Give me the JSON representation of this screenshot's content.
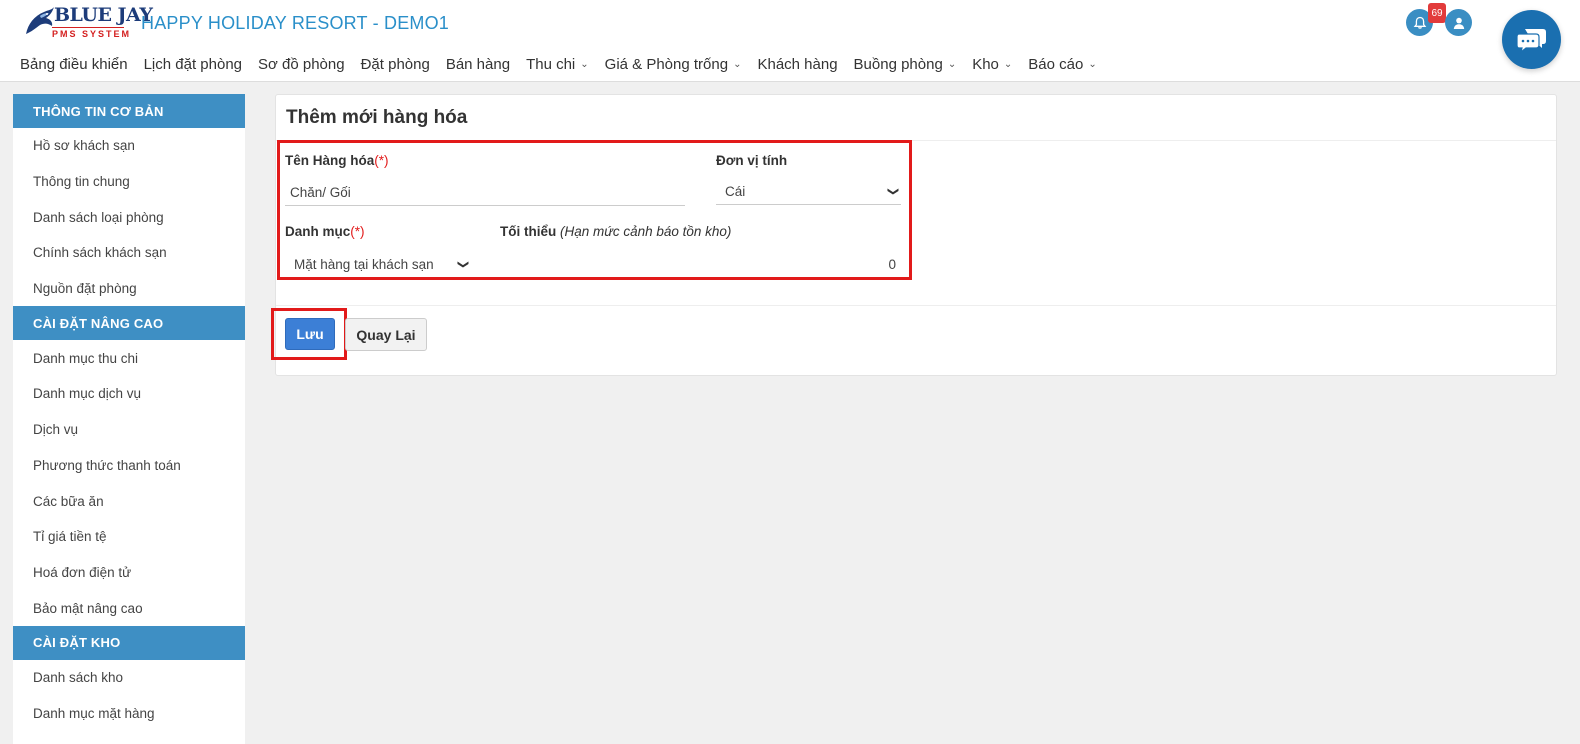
{
  "brand": {
    "logo_main": "BLUE JAY",
    "logo_sub": "PMS SYSTEM",
    "app_title": "HAPPY HOLIDAY RESORT - DEMO1",
    "colors": {
      "primary": "#3e8fc4",
      "accent": "#2a8fc9",
      "danger": "#e21a1a",
      "button": "#3c7fd6"
    }
  },
  "nav": {
    "items": [
      {
        "label": "Bảng điều khiển",
        "dropdown": false
      },
      {
        "label": "Lịch đặt phòng",
        "dropdown": false
      },
      {
        "label": "Sơ đồ phòng",
        "dropdown": false
      },
      {
        "label": "Đặt phòng",
        "dropdown": false
      },
      {
        "label": "Bán hàng",
        "dropdown": false
      },
      {
        "label": "Thu chi",
        "dropdown": true
      },
      {
        "label": "Giá & Phòng trống",
        "dropdown": true
      },
      {
        "label": "Khách hàng",
        "dropdown": false
      },
      {
        "label": "Buồng phòng",
        "dropdown": true
      },
      {
        "label": "Kho",
        "dropdown": true
      },
      {
        "label": "Báo cáo",
        "dropdown": true
      }
    ]
  },
  "header_icons": {
    "notification_count": "69",
    "notification_icon": "bell-icon",
    "user_icon": "user-icon",
    "chat_icon": "chat-icon"
  },
  "sidebar": {
    "sections": [
      {
        "title": "THÔNG TIN CƠ BẢN",
        "items": [
          "Hồ sơ khách sạn",
          "Thông tin chung",
          "Danh sách loại phòng",
          "Chính sách khách sạn",
          "Nguồn đặt phòng"
        ]
      },
      {
        "title": "CÀI ĐẶT NÂNG CAO",
        "items": [
          "Danh mục thu chi",
          "Danh mục dịch vụ",
          "Dịch vụ",
          "Phương thức thanh toán",
          "Các bữa ăn",
          "Tỉ giá tiền tệ",
          "Hoá đơn điện tử",
          "Bảo mật nâng cao"
        ]
      },
      {
        "title": "CÀI ĐẶT KHO",
        "items": [
          "Danh sách kho",
          "Danh mục mặt hàng"
        ]
      }
    ]
  },
  "form": {
    "title": "Thêm mới hàng hóa",
    "required_mark": "(*)",
    "name_label": "Tên Hàng hóa",
    "name_value": "Chăn/ Gối",
    "unit_label": "Đơn vị tính",
    "unit_value": "Cái",
    "category_label": "Danh mục",
    "category_value": "Mặt hàng tại khách sạn",
    "min_label": "Tối thiểu",
    "min_hint": "(Hạn mức cảnh báo tồn kho)",
    "min_value": "0"
  },
  "actions": {
    "save_label": "Lưu",
    "back_label": "Quay Lại"
  }
}
